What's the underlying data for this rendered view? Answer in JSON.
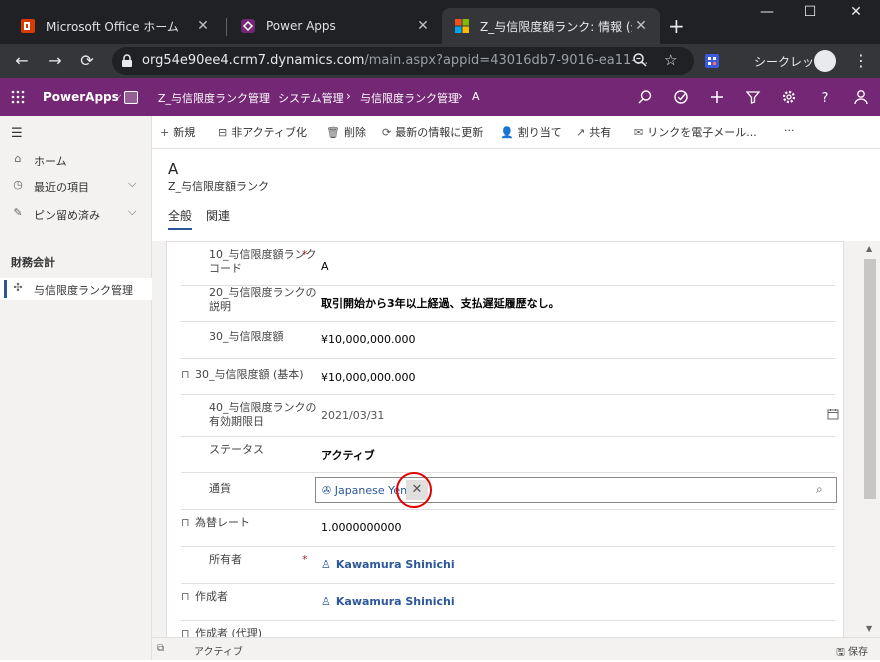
{
  "browser": {
    "tabs": [
      {
        "title": "Microsoft Office ホーム",
        "icon": "office-icon"
      },
      {
        "title": "Power Apps",
        "icon": "powerapps-icon"
      },
      {
        "title": "Z_与信限度額ランク: 情報 (全",
        "icon": "dynamics-icon"
      }
    ],
    "new_tab": "+",
    "url_host": "org54e90ee4.crm7.dynamics.com",
    "url_path": "/main.aspx?appid=43016db7-9016-ea11-...",
    "incognito_label": "シークレット"
  },
  "appbar": {
    "brand": "PowerApps",
    "breadcrumbs": [
      "Z_与信限度ランク管理",
      "システム管理",
      "与信限度ランク管理",
      "A"
    ],
    "colors": {
      "primary": "#742774"
    }
  },
  "leftnav": {
    "items": [
      {
        "label": "ホーム",
        "icon": "home-icon"
      },
      {
        "label": "最近の項目",
        "icon": "clock-icon"
      },
      {
        "label": "ピン留め済み",
        "icon": "pin-icon"
      }
    ],
    "group": "財務会計",
    "selected_item": {
      "label": "与信限度ランク管理",
      "icon": "puzzle-icon"
    }
  },
  "commands": [
    {
      "label": "新規",
      "icon": "+"
    },
    {
      "label": "非アクティブ化",
      "icon": "⊟"
    },
    {
      "label": "削除",
      "icon": "🗑"
    },
    {
      "label": "最新の情報に更新",
      "icon": "⟳"
    },
    {
      "label": "割り当て",
      "icon": "👤"
    },
    {
      "label": "共有",
      "icon": "↗"
    },
    {
      "label": "リンクを電子メール...",
      "icon": "✉"
    },
    {
      "label": "···",
      "icon": ""
    }
  ],
  "header": {
    "title": "A",
    "entity": "Z_与信限度額ランク",
    "tabs": [
      "全般",
      "関連"
    ]
  },
  "form": {
    "rows": [
      {
        "label": "10_与信限度額ランクコード",
        "value": "A"
      },
      {
        "label": "20_与信限度ランクの説明",
        "value": "取引開始から3年以上経過、支払遅延履歴なし。"
      },
      {
        "label": "30_与信限度額",
        "value": "¥10,000,000.000"
      },
      {
        "label": "30_与信限度額 (基本)",
        "value": "¥10,000,000.000"
      },
      {
        "label": "40_与信限度ランクの有効期限日",
        "value": "2021/03/31"
      },
      {
        "label": "ステータス",
        "value": "アクティブ"
      },
      {
        "label": "通貨",
        "value": "Japanese Yen"
      },
      {
        "label": "為替レート",
        "value": "1.0000000000"
      },
      {
        "label": "所有者",
        "value": "Kawamura Shinichi"
      },
      {
        "label": "作成者",
        "value": "Kawamura Shinichi"
      },
      {
        "label": "作成者 (代理)",
        "value": "---"
      }
    ],
    "required_mark": "*"
  },
  "statusbar": {
    "status": "アクティブ",
    "save": "保存"
  }
}
